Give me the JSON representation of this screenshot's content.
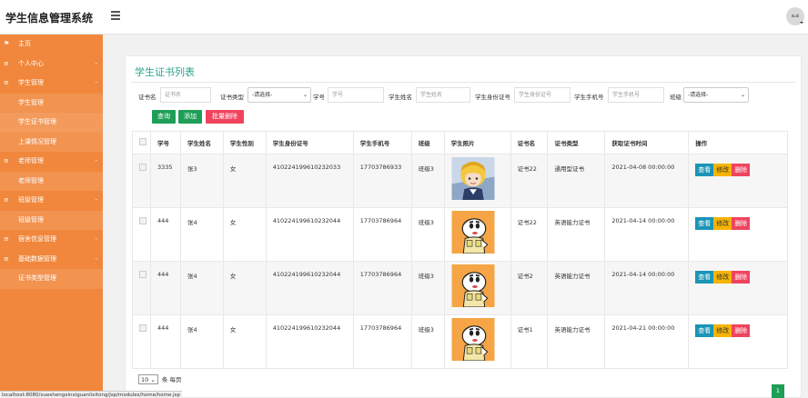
{
  "header": {
    "title": "学生信息管理系统",
    "avatar_text": "dudi"
  },
  "sidebar": {
    "items": [
      {
        "label": "主页",
        "icon": "flag-icon",
        "type": "top",
        "arrow": ""
      },
      {
        "label": "个人中心",
        "icon": "menu-icon",
        "type": "top",
        "arrow": "-"
      },
      {
        "label": "学生管理",
        "icon": "menu-icon",
        "type": "top",
        "arrow": "-"
      },
      {
        "label": "学生管理",
        "type": "sub"
      },
      {
        "label": "学生证书管理",
        "type": "sub"
      },
      {
        "label": "上课情况管理",
        "type": "sub"
      },
      {
        "label": "老师管理",
        "icon": "menu-icon",
        "type": "top",
        "arrow": "-"
      },
      {
        "label": "老师管理",
        "type": "sub"
      },
      {
        "label": "班级管理",
        "icon": "menu-icon",
        "type": "top",
        "arrow": "-"
      },
      {
        "label": "班级管理",
        "type": "sub"
      },
      {
        "label": "宿舍信息管理",
        "icon": "menu-icon",
        "type": "top",
        "arrow": "-"
      },
      {
        "label": "基础数据管理",
        "icon": "menu-icon",
        "type": "top",
        "arrow": "-"
      },
      {
        "label": "证书类型管理",
        "type": "sub"
      }
    ]
  },
  "status_url": "localhost:8080/xueshengxinxiguanlixitong/jsp/modules/home/home.jsp",
  "page": {
    "title": "学生证书列表"
  },
  "filters": {
    "cert_name_label": "证书名",
    "cert_name_placeholder": "证书名",
    "cert_type_label": "证书类型",
    "cert_type_value": "-请选择-",
    "student_no_label": "学号",
    "student_no_placeholder": "学号",
    "student_name_label": "学生姓名",
    "student_name_placeholder": "学生姓名",
    "id_card_label": "学生身份证号",
    "id_card_placeholder": "学生身份证号",
    "phone_label": "学生手机号",
    "phone_placeholder": "学生手机号",
    "class_label": "班级",
    "class_value": "-请选择-"
  },
  "actions": {
    "search": "查询",
    "add": "添加",
    "batch_delete": "批量删除"
  },
  "table": {
    "headers": [
      "学号",
      "学生姓名",
      "学生性别",
      "学生身份证号",
      "学生手机号",
      "班级",
      "学生照片",
      "证书名",
      "证书类型",
      "获取证书时间",
      "操作"
    ],
    "rows": [
      {
        "no": "3335",
        "name": "张3",
        "gender": "女",
        "id_card": "410224199610232033",
        "phone": "17703786933",
        "class": "班级3",
        "photo": "anime",
        "cert": "证书22",
        "cert_type": "通用型证书",
        "time": "2021-04-08 00:00:00"
      },
      {
        "no": "444",
        "name": "张4",
        "gender": "女",
        "id_card": "410224199610232044",
        "phone": "17703786964",
        "class": "班级3",
        "photo": "shinchan",
        "cert": "证书22",
        "cert_type": "英语能力证书",
        "time": "2021-04-14 00:00:00"
      },
      {
        "no": "444",
        "name": "张4",
        "gender": "女",
        "id_card": "410224199610232044",
        "phone": "17703786964",
        "class": "班级3",
        "photo": "shinchan",
        "cert": "证书2",
        "cert_type": "英语能力证书",
        "time": "2021-04-14 00:00:00"
      },
      {
        "no": "444",
        "name": "张4",
        "gender": "女",
        "id_card": "410224199610232044",
        "phone": "17703786964",
        "class": "班级3",
        "photo": "shinchan",
        "cert": "证书1",
        "cert_type": "英语能力证书",
        "time": "2021-04-21 00:00:00"
      }
    ],
    "row_actions": {
      "view": "查看",
      "edit": "修改",
      "delete": "删除"
    }
  },
  "pagination": {
    "page_size": "10",
    "page_size_suffix": "条 每页",
    "current_page": "1"
  },
  "colors": {
    "sidebar": "#f0873c",
    "accent_green": "#1e9e57",
    "title_teal": "#2aa58a",
    "danger": "#f0445e",
    "info": "#1a95b5",
    "warning": "#f5b400"
  }
}
